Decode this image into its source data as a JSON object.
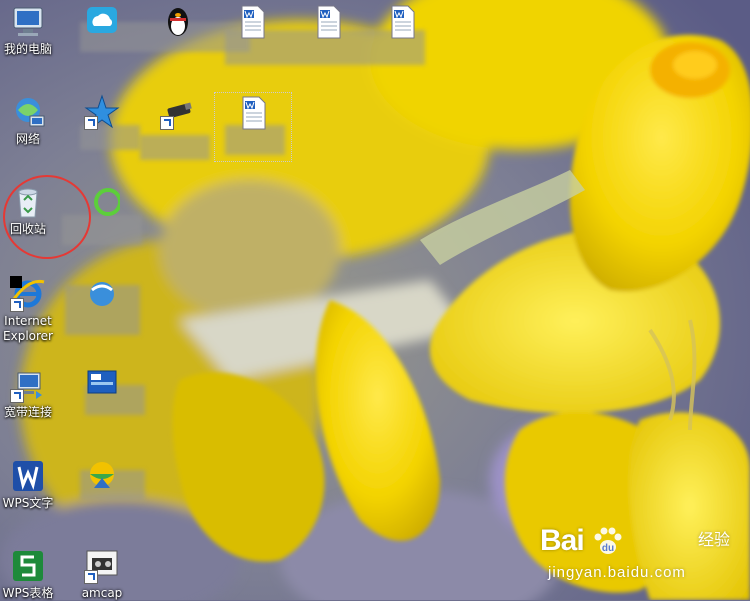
{
  "desktop": {
    "icons": [
      {
        "label": "我的电脑"
      },
      {
        "label": "网络"
      },
      {
        "label": "回收站"
      },
      {
        "label": "Internet Explorer"
      },
      {
        "label": "宽带连接"
      },
      {
        "label": "WPS文字"
      },
      {
        "label": "WPS表格"
      },
      {
        "label": "amcap"
      }
    ],
    "highlight_color": "#e53935",
    "wallpaper_colors": {
      "petal": "#f2d000",
      "petal_light": "#ffe94a",
      "background": "#6d6f8c"
    }
  },
  "watermark": {
    "main": "Bai",
    "sub": "经验",
    "url": "jingyan.baidu.com"
  }
}
